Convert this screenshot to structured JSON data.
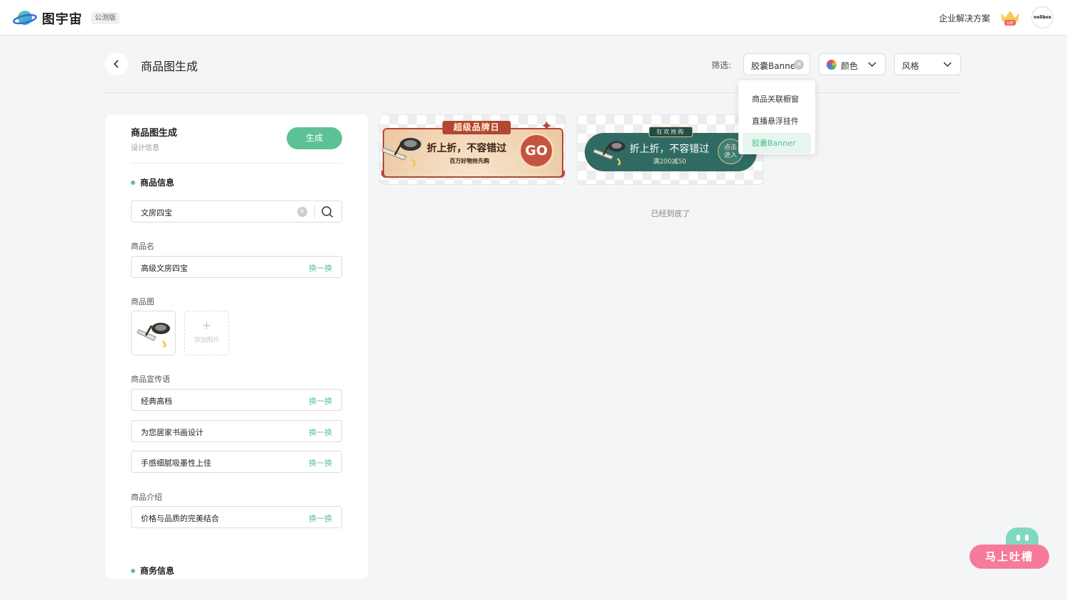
{
  "topbar": {
    "brand": "图宇宙",
    "beta_badge": "公测版",
    "enterprise_link": "企业解决方案",
    "avatar_text": "nolibox"
  },
  "header": {
    "title": "商品图生成",
    "filter_label": "筛选:",
    "filters": {
      "type_value": "胶囊Banner",
      "color_label": "颜色",
      "style_label": "风格"
    },
    "dropdown_options": [
      "商品关联橱窗",
      "直播悬浮挂件",
      "胶囊Banner"
    ],
    "dropdown_selected": "胶囊Banner"
  },
  "panel": {
    "title": "商品图生成",
    "subtitle": "设计信息",
    "generate_label": "生成",
    "section_product": "商品信息",
    "search_value": "文房四宝",
    "name_label": "商品名",
    "name_value": "高级文房四宝",
    "swap_label": "换一换",
    "image_label": "商品图",
    "add_image_label": "添加图片",
    "slogan_label": "商品宣传语",
    "slogans": [
      "经典高档",
      "为您居家书画设计",
      "手感细腻吸墨性上佳"
    ],
    "intro_label": "商品介绍",
    "intro_value": "价格与品质的完美结合",
    "section_business": "商务信息"
  },
  "banners": [
    {
      "title": "超级品牌日",
      "main": "折上折，不容错过",
      "sub": "百万好物抢先购",
      "cta": "GO"
    },
    {
      "title": "狂欢抢购",
      "main": "折上折，不容错过",
      "sub": "满200减50",
      "cta_line1": "点击",
      "cta_line2": "进入"
    }
  ],
  "end_text": "已经到底了",
  "feedback_label": "马上吐槽",
  "colors": {
    "accent": "#5cc295",
    "banner1_red": "#b44634",
    "banner2_teal": "#2f6b63",
    "feedback_pink": "#f67a9a"
  }
}
